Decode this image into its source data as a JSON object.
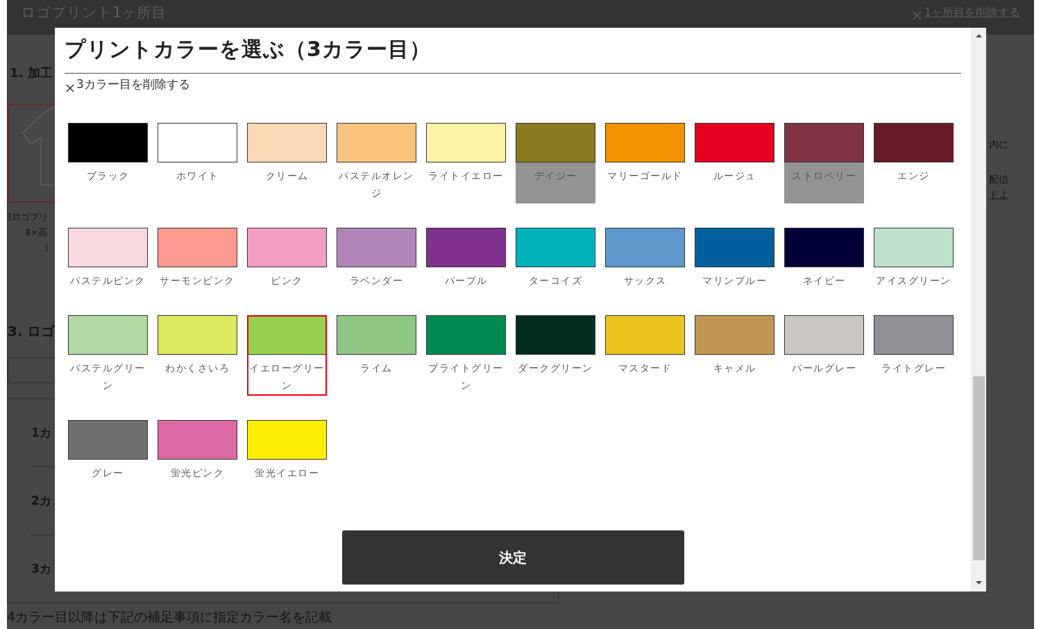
{
  "page": {
    "header": {
      "title": "ロゴプリント1ヶ所目",
      "delete_link": "1ヶ所目を削除する"
    },
    "left_column": {
      "section_1": "1. 加工",
      "thumbnail_caption": [
        "[ロゴプリ",
        "8×高",
        "("
      ],
      "section_3": "3. ロゴ",
      "color_rows": [
        "1カ",
        "2カ",
        "3カ"
      ]
    },
    "right_column": [
      {
        "kind": "text",
        "text": "内に"
      },
      {
        "kind": "text",
        "text": "配信"
      },
      {
        "kind": "link",
        "text": "ドよ"
      }
    ],
    "footnote": "4カラー目以降は下記の補足事項に指定カラー名を記載"
  },
  "modal": {
    "title": "プリントカラーを選ぶ（3カラー目）",
    "delete_link": "3カラー目を削除する",
    "colors": [
      {
        "name": "ブラック",
        "color": "#000000",
        "selected": false,
        "disabled": false
      },
      {
        "name": "ホワイト",
        "color": "#ffffff",
        "selected": false,
        "disabled": false
      },
      {
        "name": "クリーム",
        "color": "#fbd8b5",
        "selected": false,
        "disabled": false
      },
      {
        "name": "パステルオレンジ",
        "color": "#f9c57e",
        "selected": false,
        "disabled": false
      },
      {
        "name": "ライトイエロー",
        "color": "#faf2a6",
        "selected": false,
        "disabled": false
      },
      {
        "name": "デイジー",
        "color": "#8b7a22",
        "selected": false,
        "disabled": true
      },
      {
        "name": "マリーゴールド",
        "color": "#f39201",
        "selected": false,
        "disabled": false
      },
      {
        "name": "ルージュ",
        "color": "#e6001f",
        "selected": false,
        "disabled": false
      },
      {
        "name": "ストロベリー",
        "color": "#7e3242",
        "selected": false,
        "disabled": true
      },
      {
        "name": "エンジ",
        "color": "#671c25",
        "selected": false,
        "disabled": false
      },
      {
        "name": "パステルピンク",
        "color": "#f9d8df",
        "selected": false,
        "disabled": false
      },
      {
        "name": "サーモンピンク",
        "color": "#fd9a90",
        "selected": false,
        "disabled": false
      },
      {
        "name": "ピンク",
        "color": "#f19ec2",
        "selected": false,
        "disabled": false
      },
      {
        "name": "ラベンダー",
        "color": "#b185b9",
        "selected": false,
        "disabled": false
      },
      {
        "name": "パープル",
        "color": "#7e318e",
        "selected": false,
        "disabled": false
      },
      {
        "name": "ターコイズ",
        "color": "#00b2bb",
        "selected": false,
        "disabled": false
      },
      {
        "name": "サックス",
        "color": "#5f98cc",
        "selected": false,
        "disabled": false
      },
      {
        "name": "マリンブルー",
        "color": "#00609f",
        "selected": false,
        "disabled": false
      },
      {
        "name": "ネイビー",
        "color": "#020239",
        "selected": false,
        "disabled": false
      },
      {
        "name": "アイスグリーン",
        "color": "#bde1ca",
        "selected": false,
        "disabled": false
      },
      {
        "name": "パステルグリーン",
        "color": "#b2d9a1",
        "selected": false,
        "disabled": false
      },
      {
        "name": "わかくさいろ",
        "color": "#dde861",
        "selected": false,
        "disabled": false
      },
      {
        "name": "イエローグリーン",
        "color": "#97cf4e",
        "selected": true,
        "disabled": false
      },
      {
        "name": "ライム",
        "color": "#8dc783",
        "selected": false,
        "disabled": false
      },
      {
        "name": "ブライトグリーン",
        "color": "#008a50",
        "selected": false,
        "disabled": false
      },
      {
        "name": "ダークグリーン",
        "color": "#012d1f",
        "selected": false,
        "disabled": false
      },
      {
        "name": "マスタード",
        "color": "#e9c41f",
        "selected": false,
        "disabled": false
      },
      {
        "name": "キャメル",
        "color": "#c19552",
        "selected": false,
        "disabled": false
      },
      {
        "name": "パールグレー",
        "color": "#c9c5c0",
        "selected": false,
        "disabled": false
      },
      {
        "name": "ライトグレー",
        "color": "#8e9095",
        "selected": false,
        "disabled": false
      },
      {
        "name": "グレー",
        "color": "#707070",
        "selected": false,
        "disabled": false
      },
      {
        "name": "蛍光ピンク",
        "color": "#dd6aa5",
        "selected": false,
        "disabled": false
      },
      {
        "name": "蛍光イエロー",
        "color": "#fbee00",
        "selected": false,
        "disabled": false
      }
    ],
    "confirm_button": "決定"
  }
}
